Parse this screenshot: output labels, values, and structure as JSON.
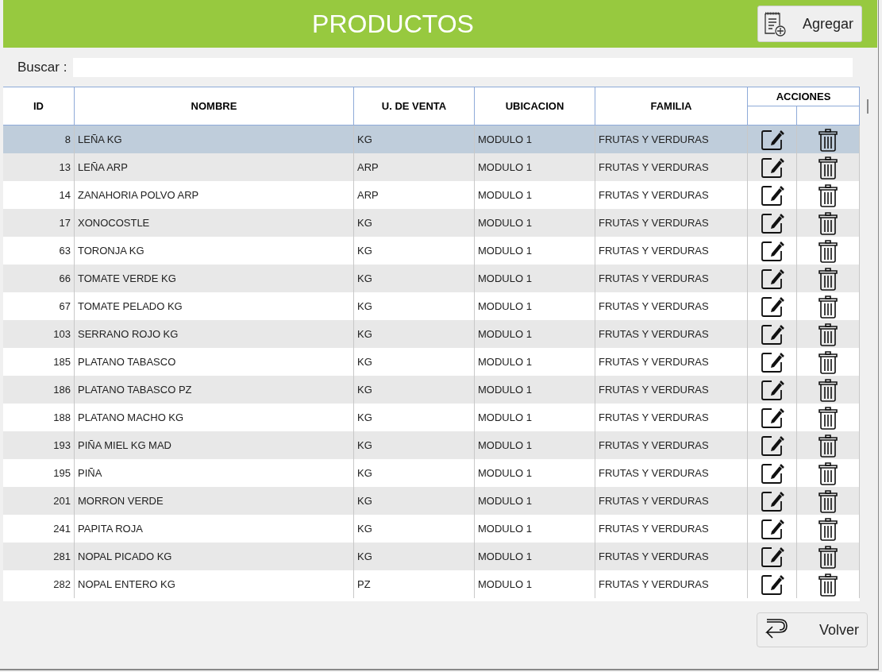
{
  "header": {
    "title": "PRODUCTOS",
    "add_button": "Agregar"
  },
  "search": {
    "label": "Buscar :"
  },
  "table": {
    "columns": [
      "ID",
      "NOMBRE",
      "U. DE VENTA",
      "UBICACION",
      "FAMILIA"
    ],
    "actions_header": "ACCIONES",
    "rows": [
      {
        "id": "8",
        "name": "LEÑA KG",
        "unit": "KG",
        "location": "MODULO 1",
        "family": "FRUTAS Y VERDURAS",
        "selected": true
      },
      {
        "id": "13",
        "name": "LEÑA ARP",
        "unit": "ARP",
        "location": "MODULO 1",
        "family": "FRUTAS Y VERDURAS",
        "selected": false
      },
      {
        "id": "14",
        "name": "ZANAHORIA POLVO ARP",
        "unit": "ARP",
        "location": "MODULO 1",
        "family": "FRUTAS Y VERDURAS",
        "selected": false
      },
      {
        "id": "17",
        "name": "XONOCOSTLE",
        "unit": "KG",
        "location": "MODULO 1",
        "family": "FRUTAS Y VERDURAS",
        "selected": false
      },
      {
        "id": "63",
        "name": "TORONJA KG",
        "unit": "KG",
        "location": "MODULO 1",
        "family": "FRUTAS Y VERDURAS",
        "selected": false
      },
      {
        "id": "66",
        "name": "TOMATE VERDE KG",
        "unit": "KG",
        "location": "MODULO 1",
        "family": "FRUTAS Y VERDURAS",
        "selected": false
      },
      {
        "id": "67",
        "name": "TOMATE PELADO KG",
        "unit": "KG",
        "location": "MODULO 1",
        "family": "FRUTAS Y VERDURAS",
        "selected": false
      },
      {
        "id": "103",
        "name": "SERRANO ROJO KG",
        "unit": "KG",
        "location": "MODULO 1",
        "family": "FRUTAS Y VERDURAS",
        "selected": false
      },
      {
        "id": "185",
        "name": "PLATANO TABASCO",
        "unit": "KG",
        "location": "MODULO 1",
        "family": "FRUTAS Y VERDURAS",
        "selected": false
      },
      {
        "id": "186",
        "name": "PLATANO TABASCO PZ",
        "unit": "KG",
        "location": "MODULO 1",
        "family": "FRUTAS Y VERDURAS",
        "selected": false
      },
      {
        "id": "188",
        "name": "PLATANO MACHO KG",
        "unit": "KG",
        "location": "MODULO 1",
        "family": "FRUTAS Y VERDURAS",
        "selected": false
      },
      {
        "id": "193",
        "name": "PIÑA MIEL KG MAD",
        "unit": "KG",
        "location": "MODULO 1",
        "family": "FRUTAS Y VERDURAS",
        "selected": false
      },
      {
        "id": "195",
        "name": "PIÑA",
        "unit": "KG",
        "location": "MODULO 1",
        "family": "FRUTAS Y VERDURAS",
        "selected": false
      },
      {
        "id": "201",
        "name": "MORRON VERDE",
        "unit": "KG",
        "location": "MODULO 1",
        "family": "FRUTAS Y VERDURAS",
        "selected": false
      },
      {
        "id": "241",
        "name": "PAPITA ROJA",
        "unit": "KG",
        "location": "MODULO 1",
        "family": "FRUTAS Y VERDURAS",
        "selected": false
      },
      {
        "id": "281",
        "name": "NOPAL PICADO KG",
        "unit": "KG",
        "location": "MODULO 1",
        "family": "FRUTAS Y VERDURAS",
        "selected": false
      },
      {
        "id": "282",
        "name": "NOPAL ENTERO KG",
        "unit": "PZ",
        "location": "MODULO 1",
        "family": "FRUTAS Y VERDURAS",
        "selected": false
      }
    ]
  },
  "back_button": "Volver"
}
